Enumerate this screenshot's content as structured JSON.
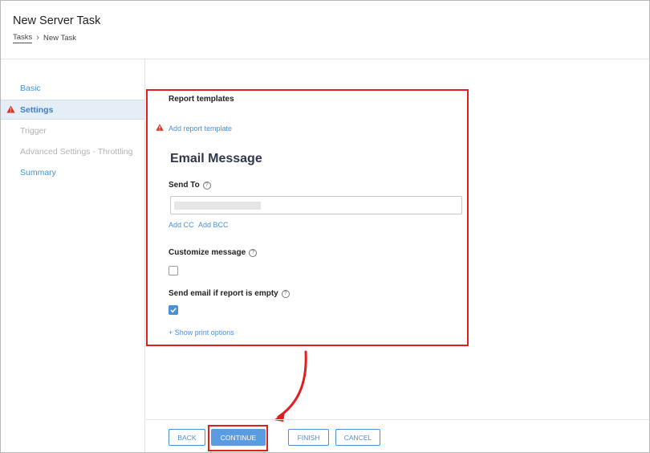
{
  "header": {
    "title": "New Server Task",
    "breadcrumb": {
      "root": "Tasks",
      "current": "New Task"
    }
  },
  "sidebar": {
    "items": [
      {
        "label": "Basic",
        "state": "link"
      },
      {
        "label": "Settings",
        "state": "active-warning"
      },
      {
        "label": "Trigger",
        "state": "disabled"
      },
      {
        "label": "Advanced Settings - Throttling",
        "state": "disabled"
      },
      {
        "label": "Summary",
        "state": "link"
      }
    ]
  },
  "form": {
    "report_templates_label": "Report templates",
    "add_report_template": "Add report template",
    "email_heading": "Email Message",
    "send_to_label": "Send To",
    "add_cc": "Add CC",
    "add_bcc": "Add BCC",
    "customize_message_label": "Customize message",
    "customize_message_checked": false,
    "send_if_empty_label": "Send email if report is empty",
    "send_if_empty_checked": true,
    "show_print_options": "+ Show print options"
  },
  "footer": {
    "back": "BACK",
    "continue": "CONTINUE",
    "finish": "FINISH",
    "cancel": "CANCEL"
  },
  "colors": {
    "accent": "#4a90d4",
    "warning": "#d9342b",
    "highlight": "#e02020"
  },
  "icons": [
    "warning-triangle-icon",
    "help-circle-icon",
    "chevron-right-icon",
    "checkmark-icon",
    "curved-arrow-annotation"
  ]
}
